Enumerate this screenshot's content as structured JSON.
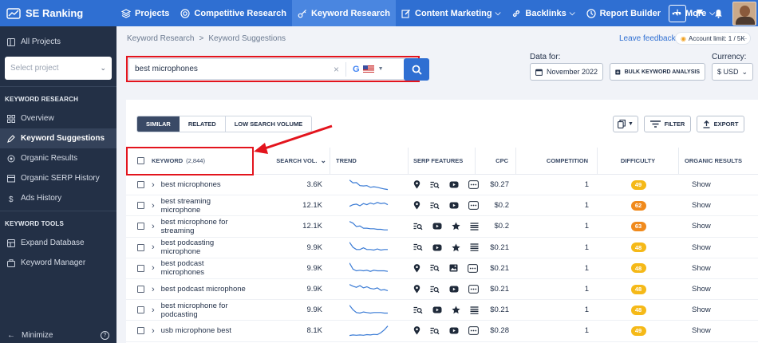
{
  "nav": {
    "logo": "SE Ranking",
    "items": [
      {
        "label": "Projects",
        "icon": "layers-icon"
      },
      {
        "label": "Competitive Research",
        "icon": "target-icon"
      },
      {
        "label": "Keyword Research",
        "icon": "key-icon",
        "active": true
      },
      {
        "label": "Content Marketing",
        "icon": "edit-icon",
        "dropdown": true
      },
      {
        "label": "Backlinks",
        "icon": "link-icon",
        "dropdown": true
      },
      {
        "label": "Report Builder",
        "icon": "clock-icon"
      },
      {
        "label": "More",
        "icon": "dots-icon",
        "dropdown": true
      }
    ]
  },
  "sidebar": {
    "all_projects": "All Projects",
    "select_placeholder": "Select project",
    "keyword_research_heading": "KEYWORD RESEARCH",
    "keyword_research_items": [
      "Overview",
      "Keyword Suggestions",
      "Organic Results",
      "Organic SERP History",
      "Ads History"
    ],
    "keyword_tools_heading": "KEYWORD TOOLS",
    "keyword_tools_items": [
      "Expand Database",
      "Keyword Manager"
    ],
    "minimize": "Minimize"
  },
  "breadcrumb": [
    "Keyword Research",
    "Keyword Suggestions"
  ],
  "leave_feedback": "Leave feedback",
  "account_limit": "Account limit: 1 / 5K",
  "search": {
    "value": "best microphones",
    "engine": "G"
  },
  "data_for_label": "Data for:",
  "date_button": "November 2022",
  "bulk_button": "BULK KEYWORD ANALYSIS",
  "currency_label": "Currency:",
  "currency_value": "$ USD",
  "tabs": [
    "SIMILAR",
    "RELATED",
    "LOW SEARCH VOLUME"
  ],
  "filter_label": "FILTER",
  "export_label": "EXPORT",
  "columns": {
    "keyword": "KEYWORD",
    "keyword_count": "(2,844)",
    "volume": "SEARCH VOL.",
    "trend": "TREND",
    "serp": "SERP FEATURES",
    "cpc": "CPC",
    "competition": "COMPETITION",
    "difficulty": "DIFFICULTY",
    "organic": "ORGANIC RESULTS"
  },
  "difficulty_colors": {
    "yellow": "#f5b918",
    "orange": "#f08a1c"
  },
  "rows": [
    {
      "keyword": "best microphones",
      "volume": "3.6K",
      "cpc": "$0.27",
      "competition": "1",
      "difficulty": "49",
      "level": "yellow",
      "organic": "Show",
      "serp": [
        "pin-icon",
        "list-search-icon",
        "video-icon",
        "more-icon"
      ],
      "trend": [
        0.95,
        0.7,
        0.72,
        0.45,
        0.42,
        0.45,
        0.3,
        0.35,
        0.3,
        0.22,
        0.15,
        0.1
      ]
    },
    {
      "keyword": "best streaming microphone",
      "volume": "12.1K",
      "cpc": "$0.2",
      "competition": "1",
      "difficulty": "62",
      "level": "orange",
      "organic": "Show",
      "serp": [
        "pin-icon",
        "list-search-icon",
        "video-icon",
        "more-icon"
      ],
      "trend": [
        0.45,
        0.6,
        0.65,
        0.5,
        0.7,
        0.6,
        0.75,
        0.65,
        0.8,
        0.7,
        0.75,
        0.6
      ]
    },
    {
      "keyword": "best microphone for streaming",
      "volume": "12.1K",
      "cpc": "$0.2",
      "competition": "1",
      "difficulty": "63",
      "level": "orange",
      "organic": "Show",
      "serp": [
        "list-search-icon",
        "video-icon",
        "star-icon",
        "lines-icon"
      ],
      "trend": [
        0.95,
        0.8,
        0.5,
        0.55,
        0.35,
        0.35,
        0.3,
        0.3,
        0.25,
        0.25,
        0.2,
        0.2
      ]
    },
    {
      "keyword": "best podcasting microphone",
      "volume": "9.9K",
      "cpc": "$0.21",
      "competition": "1",
      "difficulty": "48",
      "level": "yellow",
      "organic": "Show",
      "serp": [
        "list-search-icon",
        "video-icon",
        "star-icon",
        "lines-icon"
      ],
      "trend": [
        0.95,
        0.5,
        0.3,
        0.3,
        0.45,
        0.3,
        0.3,
        0.25,
        0.35,
        0.25,
        0.3,
        0.3
      ]
    },
    {
      "keyword": "best podcast microphones",
      "volume": "9.9K",
      "cpc": "$0.21",
      "competition": "1",
      "difficulty": "48",
      "level": "yellow",
      "organic": "Show",
      "serp": [
        "pin-icon",
        "list-search-icon",
        "image-icon",
        "more-icon"
      ],
      "trend": [
        0.95,
        0.4,
        0.25,
        0.3,
        0.25,
        0.3,
        0.2,
        0.3,
        0.25,
        0.25,
        0.25,
        0.2
      ]
    },
    {
      "keyword": "best podcast microphone",
      "volume": "9.9K",
      "cpc": "$0.21",
      "competition": "1",
      "difficulty": "48",
      "level": "yellow",
      "organic": "Show",
      "serp": [
        "pin-icon",
        "list-search-icon",
        "video-icon",
        "more-icon"
      ],
      "trend": [
        0.95,
        0.8,
        0.7,
        0.85,
        0.65,
        0.75,
        0.6,
        0.55,
        0.65,
        0.45,
        0.5,
        0.4
      ]
    },
    {
      "keyword": "best microphone for podcasting",
      "volume": "9.9K",
      "cpc": "$0.21",
      "competition": "1",
      "difficulty": "48",
      "level": "yellow",
      "organic": "Show",
      "serp": [
        "list-search-icon",
        "video-icon",
        "star-icon",
        "lines-icon"
      ],
      "trend": [
        0.95,
        0.55,
        0.3,
        0.25,
        0.35,
        0.3,
        0.25,
        0.3,
        0.3,
        0.3,
        0.25,
        0.25
      ]
    },
    {
      "keyword": "usb microphone best",
      "volume": "8.1K",
      "cpc": "$0.28",
      "competition": "1",
      "difficulty": "49",
      "level": "yellow",
      "organic": "Show",
      "serp": [
        "pin-icon",
        "list-search-icon",
        "video-icon",
        "more-icon"
      ],
      "trend": [
        0.1,
        0.15,
        0.12,
        0.15,
        0.12,
        0.18,
        0.15,
        0.2,
        0.18,
        0.35,
        0.6,
        0.95
      ]
    }
  ]
}
